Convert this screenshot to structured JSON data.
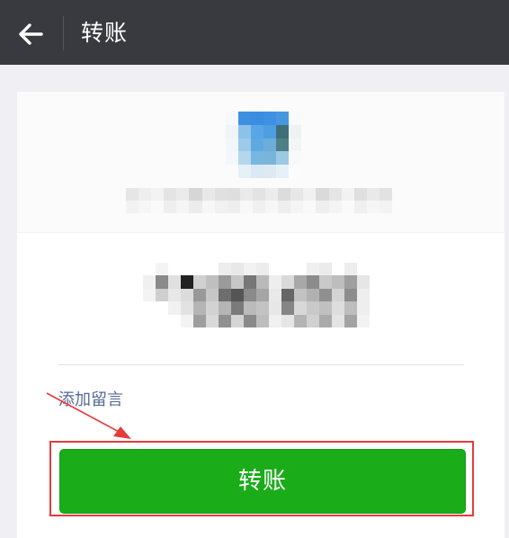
{
  "header": {
    "title": "转账",
    "back_icon": "arrow-left-icon"
  },
  "payee": {
    "avatar": "blurred-avatar",
    "name": ""
  },
  "amount": {
    "value": ""
  },
  "note_link": "添加留言",
  "transfer_button": "转账",
  "colors": {
    "topbar": "#393a3f",
    "primary": "#1aad19",
    "link": "#576b95",
    "annotation": "#e53b3b"
  }
}
